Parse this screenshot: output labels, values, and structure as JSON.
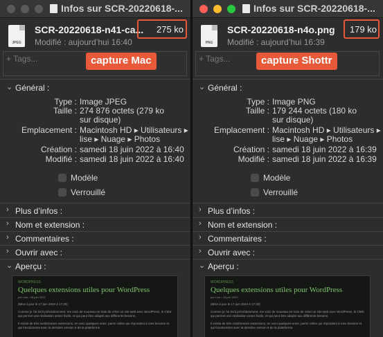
{
  "colors": {
    "accent": "#e8593a",
    "traffic_red": "#ff5f57",
    "traffic_yellow": "#febc2e",
    "traffic_green": "#28c840",
    "traffic_inactive": "#5a5a5a"
  },
  "left": {
    "window_title": "Infos sur SCR-20220618-...",
    "file_name": "SCR-20220618-n41-ca...",
    "file_size": "275 ko",
    "modified_short": "Modifié : aujourd’hui 16:40",
    "tags_placeholder": "+ Tags...",
    "callout": "capture Mac",
    "general_label": "Général :",
    "info": [
      {
        "label": "Type :",
        "value": "Image JPEG"
      },
      {
        "label": "Taille :",
        "value": "274 876 octets (279 ko"
      },
      {
        "label": "",
        "value": "sur disque)"
      },
      {
        "label": "Emplacement :",
        "value": "Macintosh HD ▸ Utilisateurs ▸"
      },
      {
        "label": "",
        "value": "lise ▸ Nuage ▸ Photos"
      },
      {
        "label": "Création :",
        "value": "samedi 18 juin 2022 à 16:40"
      },
      {
        "label": "Modifié :",
        "value": "samedi 18 juin 2022 à 16:40"
      }
    ],
    "checkboxes": [
      "Modèle",
      "Verrouillé"
    ],
    "sections": [
      "Plus d’infos :",
      "Nom et extension :",
      "Commentaires :",
      "Ouvrir avec :"
    ],
    "preview_label": "Aperçu :",
    "preview": {
      "kicker": "WORDPRESS",
      "title": "Quelques extensions utiles pour WordPress",
      "meta": "par Lise • 18 juin 2022",
      "lines": [
        "(Mise à jour le 17 juin 2022 à 17:30)",
        "Comme je l’ai écrit précédemment, me voici de nouveau en train de créer un site web avec WordPress, le CMS qui permet une réalisation assez facile, et qui peut être adapté aux différents besoins.",
        "Il existe de très nombreuses extensions, en voici quelques-unes, parmi celles qui répondent à mes besoins et qui fonctionnent avec la dernière version 6 de la plateforme."
      ]
    }
  },
  "right": {
    "window_title": "Infos sur SCR-20220618-...",
    "file_name": "SCR-20220618-n4o.png",
    "file_size": "179 ko",
    "modified_short": "Modifié : aujourd’hui 16:39",
    "tags_placeholder": "+ Tags...",
    "callout": "capture Shottr",
    "general_label": "Général :",
    "info": [
      {
        "label": "Type :",
        "value": "Image PNG"
      },
      {
        "label": "Taille :",
        "value": "179 244 octets (180 ko"
      },
      {
        "label": "",
        "value": "sur disque)"
      },
      {
        "label": "Emplacement :",
        "value": "Macintosh HD ▸ Utilisateurs ▸"
      },
      {
        "label": "",
        "value": "lise ▸ Nuage ▸ Photos"
      },
      {
        "label": "Création :",
        "value": "samedi 18 juin 2022 à 16:39"
      },
      {
        "label": "Modifié :",
        "value": "samedi 18 juin 2022 à 16:39"
      }
    ],
    "checkboxes": [
      "Modèle",
      "Verrouillé"
    ],
    "sections": [
      "Plus d’infos :",
      "Nom et extension :",
      "Commentaires :",
      "Ouvrir avec :"
    ],
    "preview_label": "Aperçu :",
    "preview": {
      "kicker": "WORDPRESS",
      "title": "Quelques extensions utiles pour WordPress",
      "meta": "par Lise • 18 juin 2022",
      "lines": [
        "(Mise à jour le 17 juin 2022 à 17:30)",
        "Comme je l’ai écrit précédemment, me voici de nouveau en train de créer un site web avec WordPress, le CMS qui permet une réalisation assez facile, et qui peut être adapté aux différents besoins.",
        "Il existe de très nombreuses extensions, en voici quelques-unes, parmi celles qui répondent à mes besoins et qui fonctionnent avec la dernière version 6 de la plateforme."
      ]
    }
  }
}
